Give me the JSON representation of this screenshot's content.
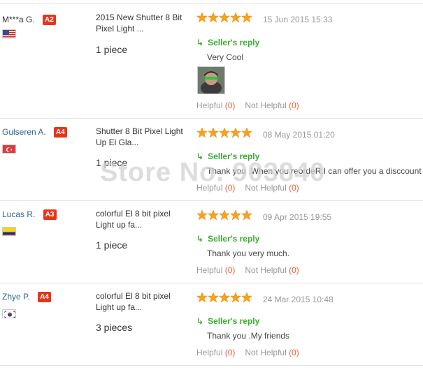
{
  "reviews": [
    {
      "buyer": "M***a G.",
      "level": "A2",
      "country": "us",
      "product": "2015 New Shutter 8 Bit Pixel Light ...",
      "quantity": "1 piece",
      "rating": 5,
      "date": "15 Jun 2015 15:33",
      "reply_label": "Seller's reply",
      "reply_text": "Very Cool",
      "has_photo": true,
      "helpful_label": "Helpful",
      "helpful_count": "(0)",
      "not_helpful_label": "Not Helpful",
      "not_helpful_count": "(0)"
    },
    {
      "buyer": "Gulseren A.",
      "level": "A4",
      "country": "tr",
      "product": "Shutter 8 Bit Pixel Light Up El Gla...",
      "quantity": "1 piece",
      "rating": 5,
      "date": "08 May 2015 01:20",
      "reply_label": "Seller's reply",
      "reply_text": "Thank you .When you reordeR.I can offer you a disccount",
      "helpful_label": "Helpful",
      "helpful_count": "(0)",
      "not_helpful_label": "Not Helpful",
      "not_helpful_count": "(0)"
    },
    {
      "buyer": "Lucas R.",
      "level": "A3",
      "country": "co",
      "product": "colorful El 8 bit pixel Light up fa...",
      "quantity": "1 piece",
      "rating": 5,
      "date": "09 Apr 2015 19:55",
      "reply_label": "Seller's reply",
      "reply_text": "Thank you very much.",
      "helpful_label": "Helpful",
      "helpful_count": "(0)",
      "not_helpful_label": "Not Helpful",
      "not_helpful_count": "(0)"
    },
    {
      "buyer": "Zhye P.",
      "level": "A4",
      "country": "kr",
      "product": "colorful El 8 bit pixel Light up fa...",
      "quantity": "3 pieces",
      "rating": 5,
      "date": "24 Mar 2015 10:48",
      "reply_label": "Seller's reply",
      "reply_text": "Thank you .My friends",
      "helpful_label": "Helpful",
      "helpful_count": "(0)",
      "not_helpful_label": "Not Helpful",
      "not_helpful_count": "(0)"
    }
  ],
  "watermark": "Store No. 903840",
  "colors": {
    "badge": "#e5361b",
    "reply": "#3aac2e",
    "star": "#f7a21b",
    "count": "#e8613c"
  }
}
